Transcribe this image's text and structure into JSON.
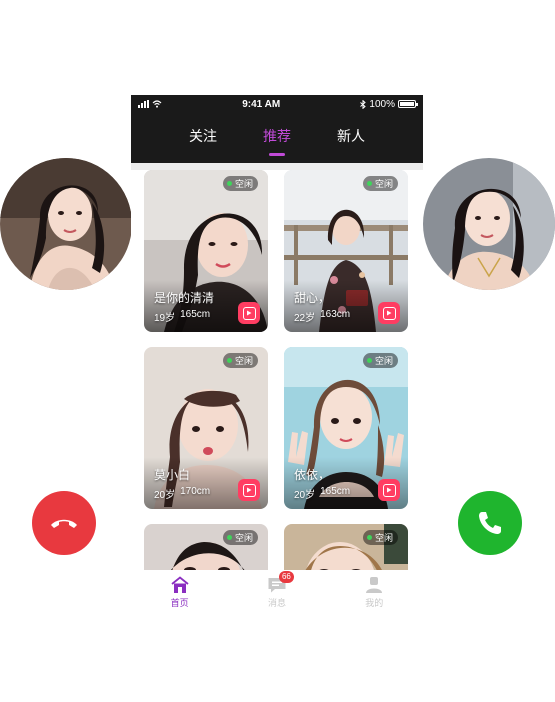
{
  "status_bar": {
    "time": "9:41 AM",
    "battery": "100%",
    "battery_level": 1.0
  },
  "tabs": [
    {
      "label": "关注",
      "active": false
    },
    {
      "label": "推荐",
      "active": true
    },
    {
      "label": "新人",
      "active": false
    }
  ],
  "cards": [
    {
      "status": "空闲",
      "name": "是你的清清",
      "age": "19岁",
      "height": "165cm"
    },
    {
      "status": "空闲",
      "name": "甜心，",
      "age": "22岁",
      "height": "163cm"
    },
    {
      "status": "空闲",
      "name": "莫小白",
      "age": "20岁",
      "height": "170cm"
    },
    {
      "status": "空闲",
      "name": "依依，",
      "age": "20岁",
      "height": "165cm"
    },
    {
      "status": "空闲",
      "name": "",
      "age": "",
      "height": ""
    },
    {
      "status": "空闲",
      "name": "",
      "age": "",
      "height": ""
    }
  ],
  "bottom_nav": [
    {
      "label": "首页",
      "icon": "home-icon",
      "active": true
    },
    {
      "label": "消息",
      "icon": "message-icon",
      "active": false,
      "badge": "66"
    },
    {
      "label": "我的",
      "icon": "profile-icon",
      "active": false
    }
  ],
  "icons": {
    "decline": "phone-hangup-icon",
    "accept": "phone-answer-icon",
    "play": "video-play-icon"
  },
  "colors": {
    "accent": "#c14bd8",
    "decline": "#e8393f",
    "accept": "#1fb52e",
    "online": "#3ed45a",
    "play": "#ff3d62",
    "header_bg": "#1a1a1a"
  }
}
